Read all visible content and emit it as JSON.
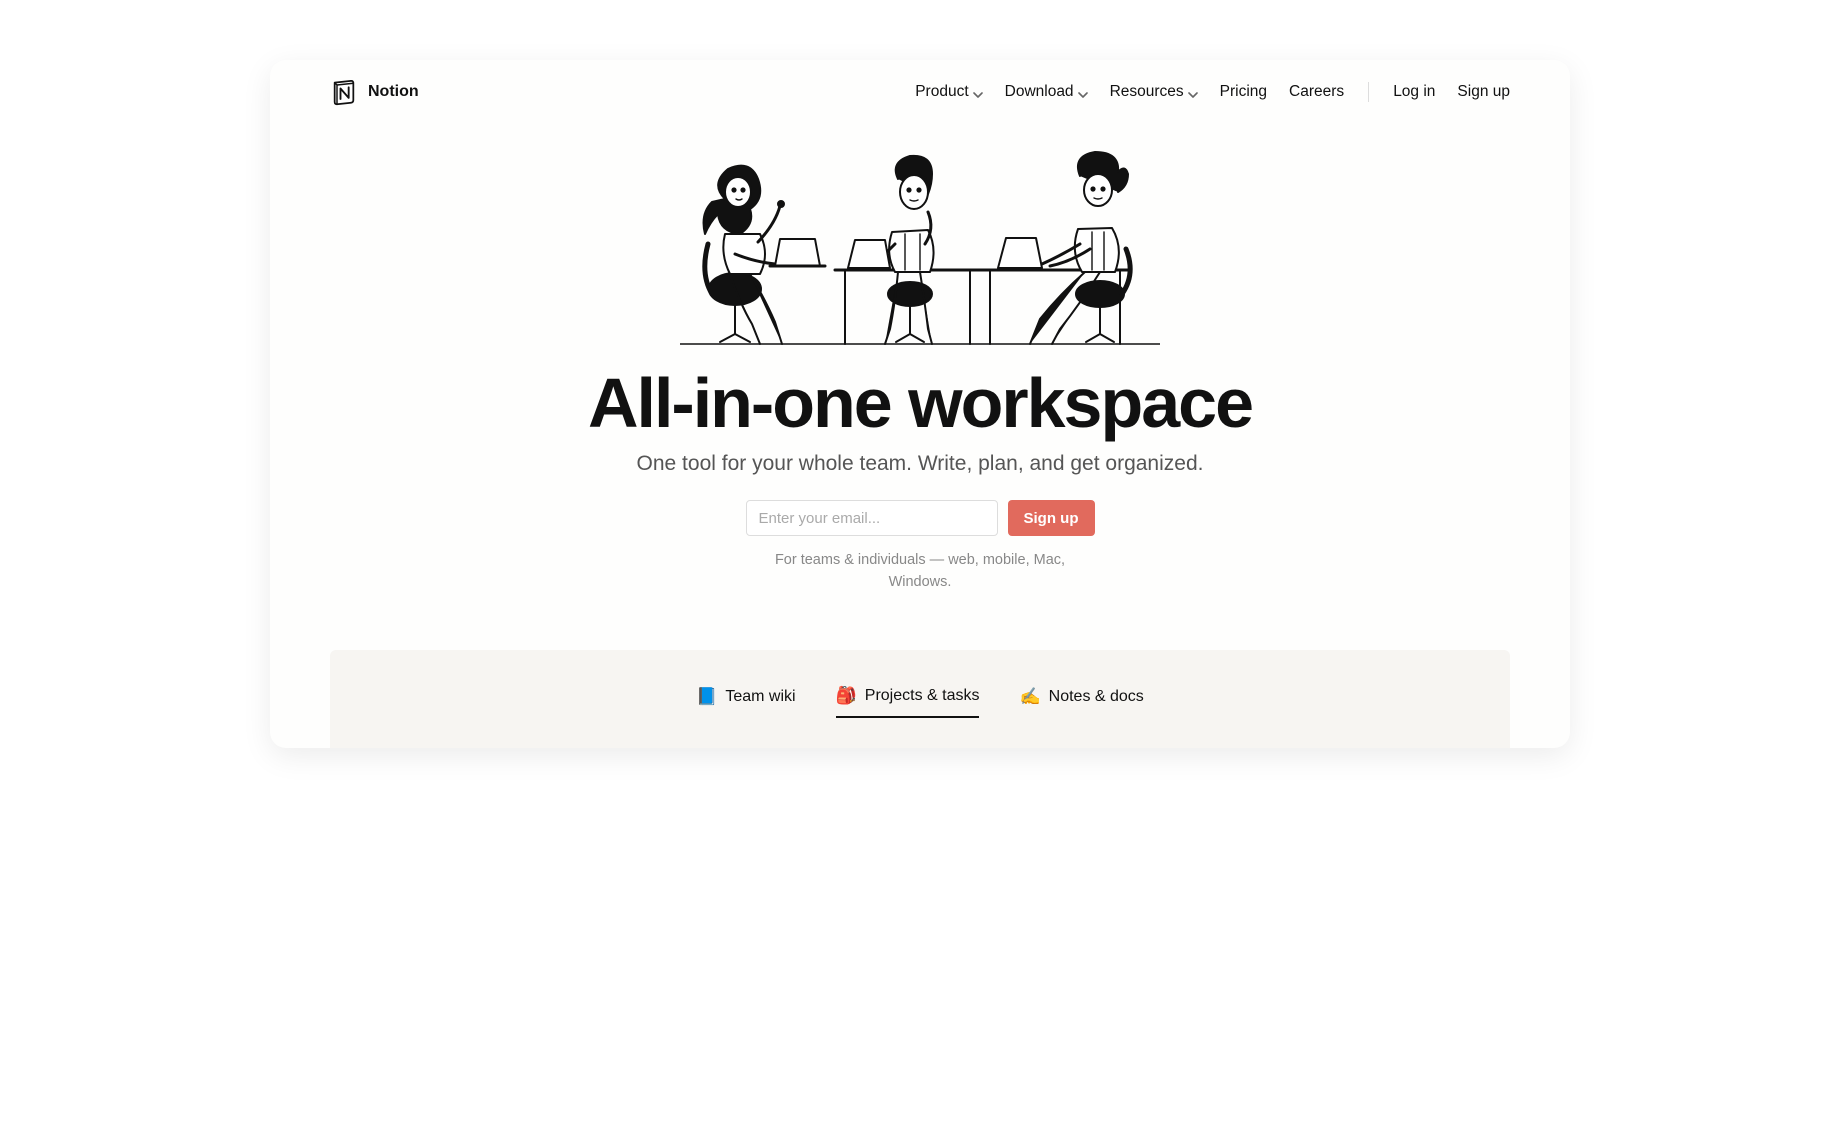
{
  "brand": {
    "name": "Notion"
  },
  "nav": {
    "items": [
      {
        "label": "Product",
        "has_chevron": true
      },
      {
        "label": "Download",
        "has_chevron": true
      },
      {
        "label": "Resources",
        "has_chevron": true
      },
      {
        "label": "Pricing",
        "has_chevron": false
      },
      {
        "label": "Careers",
        "has_chevron": false
      }
    ],
    "auth": {
      "login": "Log in",
      "signup": "Sign up"
    }
  },
  "hero": {
    "title": "All-in-one workspace",
    "subtitle": "One tool for your whole team. Write, plan, and get organized.",
    "email_placeholder": "Enter your email...",
    "signup_button": "Sign up",
    "footnote": "For teams & individuals — web, mobile, Mac, Windows."
  },
  "tabs": [
    {
      "emoji": "📘",
      "label": "Team wiki",
      "active": false
    },
    {
      "emoji": "🎒",
      "label": "Projects & tasks",
      "active": true
    },
    {
      "emoji": "✍️",
      "label": "Notes & docs",
      "active": false
    }
  ]
}
